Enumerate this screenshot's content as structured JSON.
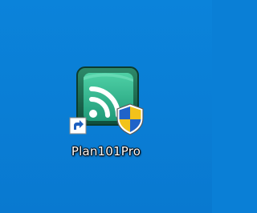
{
  "desktop": {
    "background_color": "#0a7fd6",
    "icons": [
      {
        "label": "Plan101Pro",
        "icon": "plan101pro-app-icon",
        "overlays": [
          "shortcut-arrow-icon",
          "uac-shield-icon"
        ],
        "icon_colors": {
          "frame": "#1b6f55",
          "tile": "#33b08c",
          "signal": "#ffffff",
          "shield_blue": "#1f63c9",
          "shield_yellow": "#f2c21a"
        }
      }
    ]
  }
}
